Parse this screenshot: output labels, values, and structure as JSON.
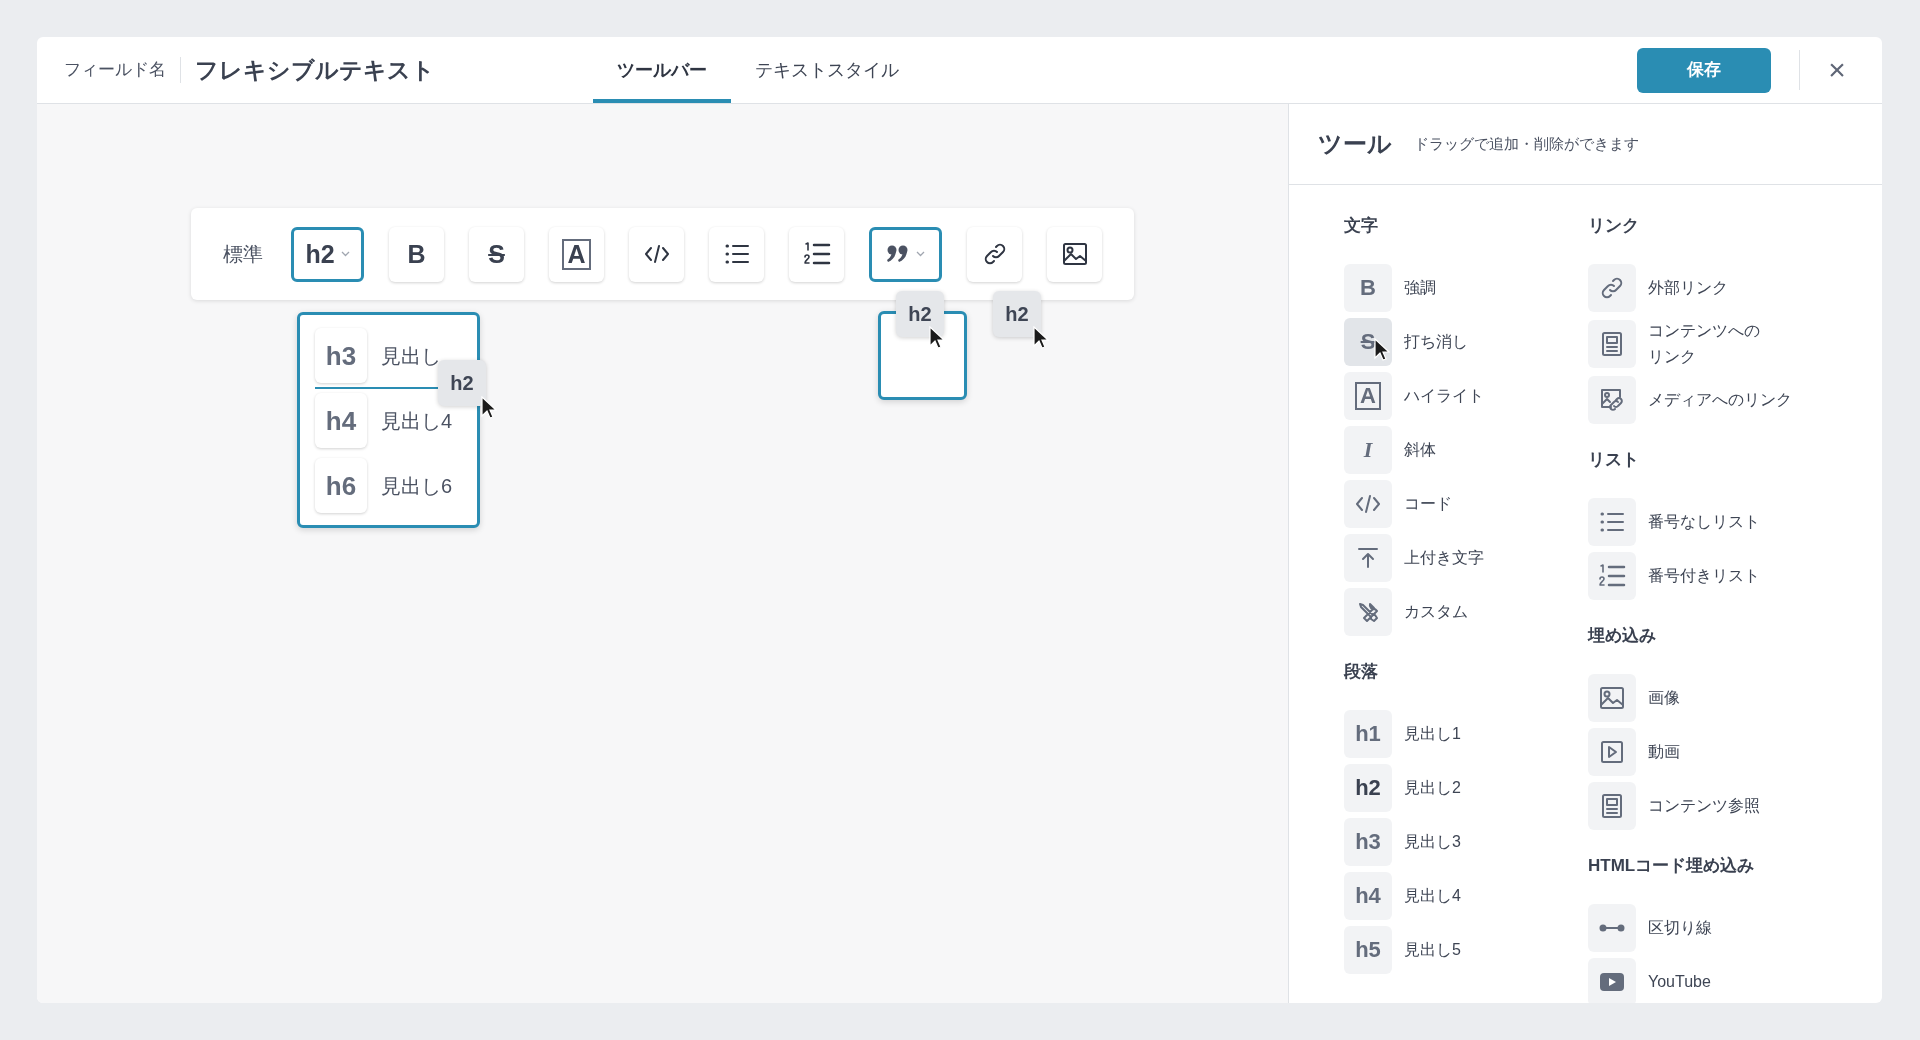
{
  "header": {
    "field_label": "フィールド名",
    "field_name": "フレキシブルテキスト",
    "save": "保存",
    "close": "×"
  },
  "tabs": [
    {
      "label": "ツールバー",
      "selected": true
    },
    {
      "label": "テキストスタイル",
      "selected": false
    }
  ],
  "toolbar": [
    {
      "kind": "label",
      "text": "標準"
    },
    {
      "kind": "heading",
      "glyph": "h2",
      "dropdown": true
    },
    {
      "kind": "bold",
      "glyph": "B",
      "dropdown": false
    },
    {
      "kind": "strike",
      "glyph": "S",
      "dropdown": false
    },
    {
      "kind": "highlight",
      "glyph": "A",
      "dropdown": false
    },
    {
      "kind": "code",
      "dropdown": false
    },
    {
      "kind": "bullet",
      "dropdown": false
    },
    {
      "kind": "numbered",
      "dropdown": false
    },
    {
      "kind": "quote",
      "dropdown": true
    },
    {
      "kind": "link",
      "dropdown": false
    },
    {
      "kind": "image",
      "dropdown": false
    }
  ],
  "heading_menu": [
    {
      "glyph": "h3",
      "label": "見出し",
      "drop_line": true
    },
    {
      "glyph": "h4",
      "label": "見出し4",
      "drop_line": false
    },
    {
      "glyph": "h6",
      "label": "見出し6",
      "drop_line": false
    }
  ],
  "drag_chips": [
    {
      "label": "h2"
    },
    {
      "label": "h2"
    },
    {
      "label": "h2"
    }
  ],
  "panel": {
    "title": "ツール",
    "hint": "ドラッグで追加・削除ができます",
    "columns": [
      [
        {
          "heading": "文字",
          "items": [
            {
              "kind": "bold",
              "glyph": "B",
              "label": "強調",
              "hovered": false,
              "active": false
            },
            {
              "kind": "strike",
              "glyph": "S",
              "label": "打ち消し",
              "hovered": true,
              "active": false
            },
            {
              "kind": "highlight",
              "glyph": "A",
              "label": "ハイライト",
              "hovered": false,
              "active": false
            },
            {
              "kind": "italic",
              "glyph": "I",
              "label": "斜体",
              "hovered": false,
              "active": false
            },
            {
              "kind": "code",
              "label": "コード",
              "hovered": false,
              "active": false
            },
            {
              "kind": "superscript",
              "label": "上付き文字",
              "hovered": false,
              "active": false
            },
            {
              "kind": "custom",
              "label": "カスタム",
              "hovered": false,
              "active": false
            }
          ]
        },
        {
          "heading": "段落",
          "items": [
            {
              "kind": "heading",
              "glyph": "h1",
              "label": "見出し1",
              "hovered": false,
              "active": false
            },
            {
              "kind": "heading",
              "glyph": "h2",
              "label": "見出し2",
              "hovered": false,
              "active": true
            },
            {
              "kind": "heading",
              "glyph": "h3",
              "label": "見出し3",
              "hovered": false,
              "active": false
            },
            {
              "kind": "heading",
              "glyph": "h4",
              "label": "見出し4",
              "hovered": false,
              "active": false
            },
            {
              "kind": "heading",
              "glyph": "h5",
              "label": "見出し5",
              "hovered": false,
              "active": false
            }
          ]
        }
      ],
      [
        {
          "heading": "リンク",
          "items": [
            {
              "kind": "link",
              "label": "外部リンク",
              "hovered": false,
              "active": false
            },
            {
              "kind": "content",
              "label": "コンテンツへの",
              "label_continued": "リンク",
              "hovered": false,
              "active": false
            },
            {
              "kind": "media-link",
              "label": "メディアへのリンク",
              "hovered": false,
              "active": false
            }
          ]
        },
        {
          "heading": "リスト",
          "items": [
            {
              "kind": "bullet",
              "label": "番号なしリスト",
              "hovered": false,
              "active": false
            },
            {
              "kind": "numbered",
              "label": "番号付きリスト",
              "hovered": false,
              "active": false
            }
          ]
        },
        {
          "heading": "埋め込み",
          "items": [
            {
              "kind": "image",
              "label": "画像",
              "hovered": false,
              "active": false
            },
            {
              "kind": "video",
              "label": "動画",
              "hovered": false,
              "active": false
            },
            {
              "kind": "content",
              "label": "コンテンツ参照",
              "hovered": false,
              "active": false
            }
          ]
        },
        {
          "heading": "HTMLコード埋め込み",
          "items": [
            {
              "kind": "divider",
              "label": "区切り線",
              "hovered": false,
              "active": false
            },
            {
              "kind": "youtube",
              "label": "YouTube",
              "hovered": false,
              "active": false
            }
          ]
        }
      ]
    ]
  }
}
